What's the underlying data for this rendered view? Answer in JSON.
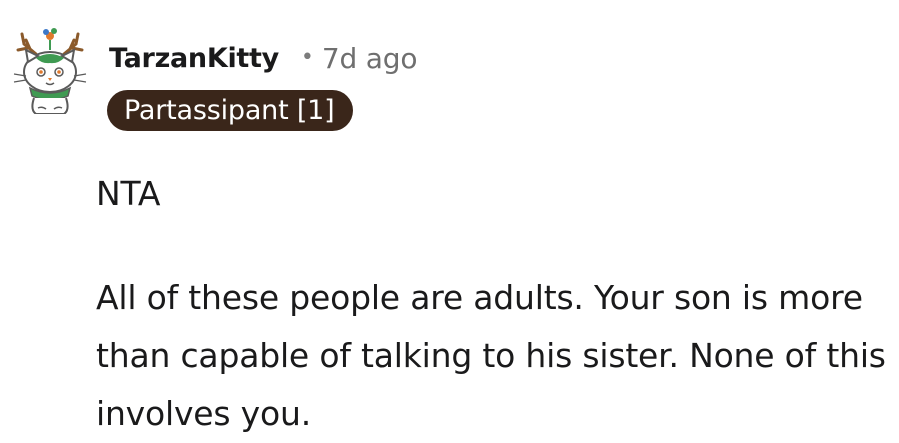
{
  "comment": {
    "author": "TarzanKitty",
    "separator": "•",
    "timestamp": "7d ago",
    "flair": "Partassipant [1]",
    "paragraphs": [
      "NTA",
      "All of these people are adults. Your son is more than capable of talking to his sister. None of this involves you."
    ]
  },
  "avatar": {
    "icon": "cat-with-antlers-avatar-icon",
    "colors": {
      "outline": "#5a5a5a",
      "green": "#3f9a52",
      "orange": "#e0792c",
      "blue": "#3c78c8"
    }
  },
  "colors": {
    "flair_background": "#3a261a",
    "flair_text": "#ffffff",
    "text": "#1a1a1b",
    "muted": "#6f6f6f"
  }
}
